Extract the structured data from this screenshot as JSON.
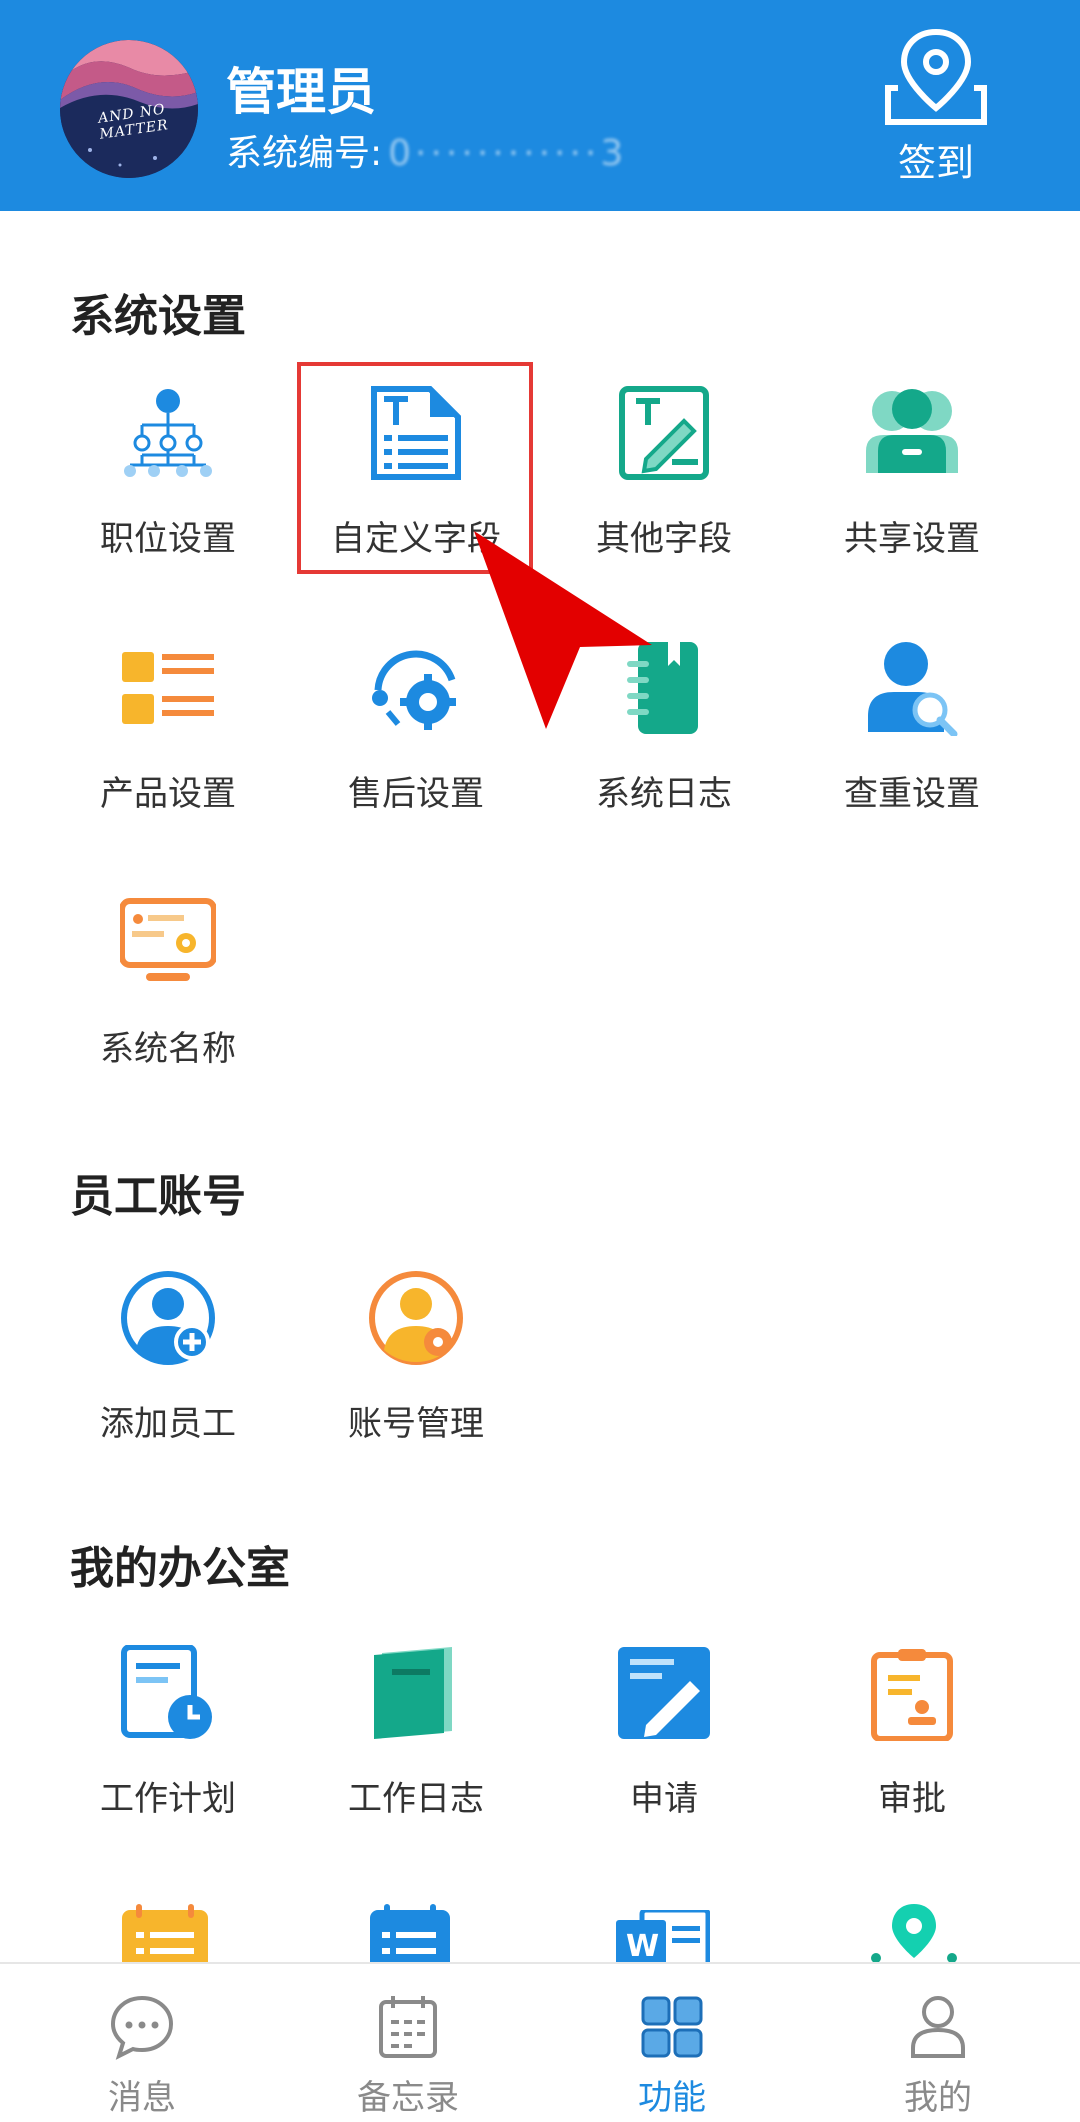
{
  "header": {
    "user_name": "管理员",
    "system_id_label": "系统编号:",
    "system_id_value": "0············3",
    "checkin_label": "签到",
    "avatar_text": "AND NO MATTER",
    "bg_color": "#1d8ae0"
  },
  "sections": {
    "system": {
      "title": "系统设置",
      "items": [
        {
          "label": "职位设置",
          "icon": "org-chart-icon"
        },
        {
          "label": "自定义字段",
          "icon": "custom-field-icon"
        },
        {
          "label": "其他字段",
          "icon": "edit-field-icon"
        },
        {
          "label": "共享设置",
          "icon": "share-users-icon"
        },
        {
          "label": "产品设置",
          "icon": "product-list-icon"
        },
        {
          "label": "售后设置",
          "icon": "after-sales-gear-icon"
        },
        {
          "label": "系统日志",
          "icon": "notebook-icon"
        },
        {
          "label": "查重设置",
          "icon": "user-search-icon"
        },
        {
          "label": "系统名称",
          "icon": "monitor-gear-icon"
        }
      ]
    },
    "staff": {
      "title": "员工账号",
      "items": [
        {
          "label": "添加员工",
          "icon": "add-user-icon"
        },
        {
          "label": "账号管理",
          "icon": "user-gear-icon"
        }
      ]
    },
    "office": {
      "title": "我的办公室",
      "items": [
        {
          "label": "工作计划",
          "icon": "plan-clock-icon"
        },
        {
          "label": "工作日志",
          "icon": "book-icon"
        },
        {
          "label": "申请",
          "icon": "apply-pen-icon"
        },
        {
          "label": "审批",
          "icon": "approval-clipboard-icon"
        }
      ]
    }
  },
  "tabbar": {
    "items": [
      {
        "label": "消息",
        "icon": "chat-bubble-icon",
        "active": false
      },
      {
        "label": "备忘录",
        "icon": "calendar-icon",
        "active": false
      },
      {
        "label": "功能",
        "icon": "grid-icon",
        "active": true
      },
      {
        "label": "我的",
        "icon": "person-icon",
        "active": false
      }
    ]
  },
  "colors": {
    "primary": "#1d8ae0",
    "highlight_border": "#e53935",
    "arrow": "#e30000",
    "teal": "#14a88a",
    "orange": "#f58a3c",
    "yellow": "#f7b52c"
  }
}
